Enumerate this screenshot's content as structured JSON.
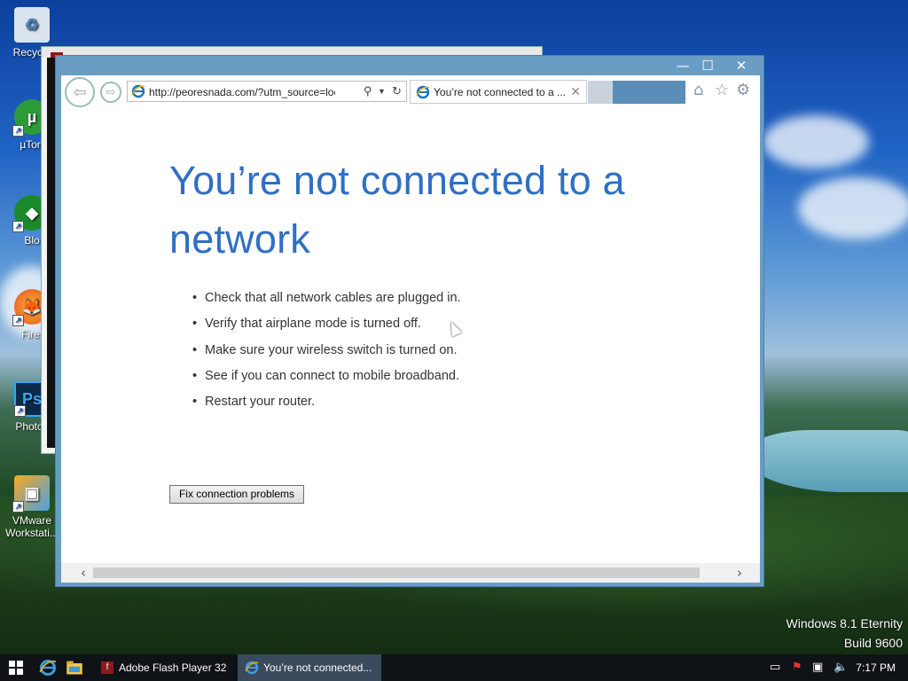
{
  "desktop": {
    "icons": [
      {
        "label": "Recycle",
        "icon": "recycle-bin-icon"
      },
      {
        "label": "µTorr",
        "icon": "utorrent-icon"
      },
      {
        "label": "Blo",
        "icon": "blockchain-icon"
      },
      {
        "label": "Firef",
        "icon": "firefox-icon"
      },
      {
        "label": "Photos",
        "icon": "photoshop-icon"
      },
      {
        "label": "VMware Workstati...",
        "icon": "vmware-icon"
      }
    ],
    "watermark": {
      "line1": "Windows 8.1 Eternity",
      "line2": "Build 9600"
    }
  },
  "browser": {
    "address": "http://peoresnada.com/?utm_source=localh",
    "tab_title": "You’re not connected to a ...",
    "window_buttons": {
      "minimize": "—",
      "maximize": "☐",
      "close": "✕"
    }
  },
  "page": {
    "heading": "You’re not connected to a network",
    "tips": [
      "Check that all network cables are plugged in.",
      "Verify that airplane mode is turned off.",
      "Make sure your wireless switch is turned on.",
      "See if you can connect to mobile broadband.",
      "Restart your router."
    ],
    "fix_button": "Fix connection problems"
  },
  "taskbar": {
    "items": [
      {
        "label": "Adobe Flash Player 32",
        "icon": "flash-player-icon"
      },
      {
        "label": "You’re not connected...",
        "icon": "internet-explorer-icon"
      }
    ],
    "clock": "7:17 PM"
  },
  "colors": {
    "heading": "#2f6fc4",
    "window_frame": "#6a9dc4",
    "taskbar": "#0f1216"
  }
}
